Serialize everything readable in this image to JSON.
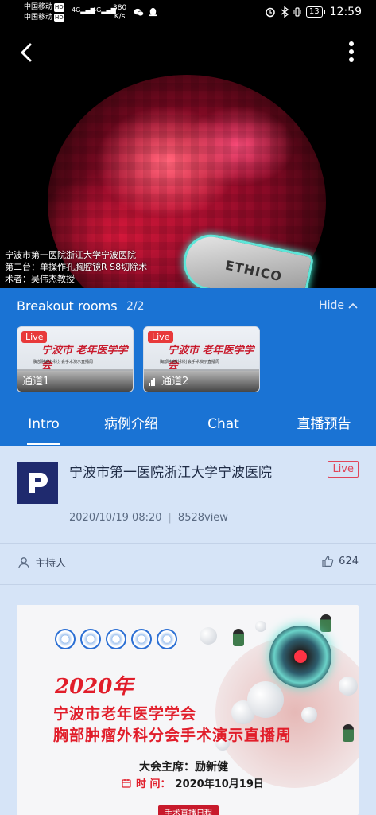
{
  "status_bar": {
    "carrier1": "中国移动",
    "carrier2": "中国移动",
    "hd": "HD",
    "net1": "4G",
    "net2": "4G",
    "speed_value": "380",
    "speed_unit": "K/s",
    "battery": "13",
    "time": "12:59"
  },
  "video": {
    "caption_lines": [
      "宁波市第一医院浙江大学宁波医院",
      "第二台：单操作孔胸腔镜R S8切除术",
      "术者：吴伟杰教授"
    ],
    "instrument_text": "ETHICO"
  },
  "breakout": {
    "title": "Breakout rooms",
    "count": "2/2",
    "hide_label": "Hide",
    "rooms": [
      {
        "live": "Live",
        "name": "通道1"
      },
      {
        "live": "Live",
        "name": "通道2"
      }
    ],
    "thumb_title": "宁波市 老年医学学会",
    "thumb_sub": "胸部肿瘤外科分会手术演示直播周"
  },
  "tabs": [
    {
      "label": "Intro",
      "active": true
    },
    {
      "label": "病例介绍",
      "active": false
    },
    {
      "label": "Chat",
      "active": false
    },
    {
      "label": "直播预告",
      "active": false
    }
  ],
  "room_info": {
    "title": "宁波市第一医院浙江大学宁波医院",
    "live": "Live",
    "datetime": "2020/10/19 08:20",
    "separator": "|",
    "views": "8528view",
    "host_label": "主持人",
    "likes": "624"
  },
  "poster": {
    "year": "2020年",
    "line1": "宁波市老年医学学会",
    "line2": "胸部肿瘤外科分会手术演示直播周",
    "chair": "大会主席：励新健",
    "time_label": "时  间：",
    "time_value": "2020年10月19日",
    "schedule": "手术直播日程"
  },
  "colors": {
    "primary": "#1a73d4",
    "background": "#d6e4f7",
    "live_red": "#e8393a",
    "poster_red": "#e11d2a"
  }
}
